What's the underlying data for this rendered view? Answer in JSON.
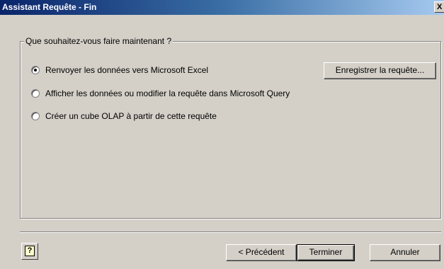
{
  "window": {
    "title": "Assistant Requête - Fin",
    "close_glyph": "X"
  },
  "group": {
    "label": "Que souhaitez-vous faire maintenant ?"
  },
  "options": [
    {
      "label": "Renvoyer les données vers Microsoft Excel",
      "selected": true
    },
    {
      "label": "Afficher les données ou modifier la requête dans Microsoft Query",
      "selected": false
    },
    {
      "label": "Créer un cube OLAP à partir de cette requête",
      "selected": false
    }
  ],
  "buttons": {
    "save_query": "Enregistrer la requête...",
    "previous": "< Précédent",
    "finish": "Terminer",
    "cancel": "Annuler",
    "help_glyph": "?"
  },
  "colors": {
    "title_gradient_start": "#0a246a",
    "title_gradient_end": "#a6caf0",
    "dialog_face": "#d4d0c8"
  }
}
